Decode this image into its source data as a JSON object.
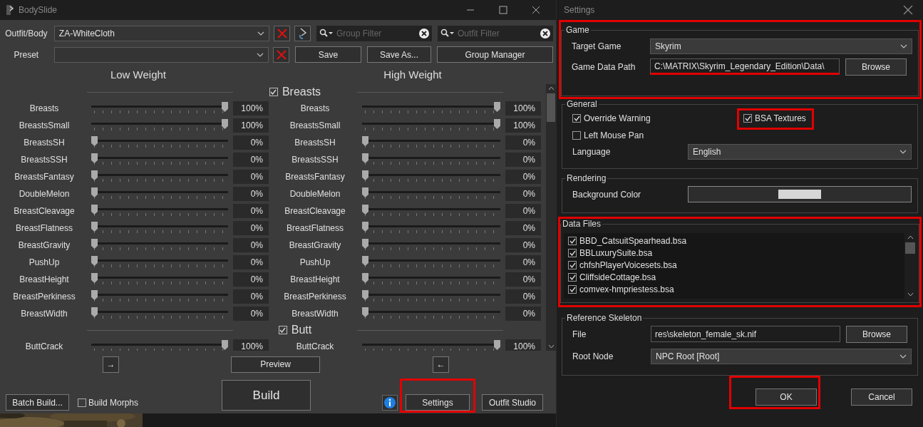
{
  "bodyslide": {
    "title": "BodySlide",
    "outfit": {
      "label": "Outfit/Body",
      "value": "ZA-WhiteCloth"
    },
    "group_filter": {
      "placeholder": "Group Filter"
    },
    "outfit_filter": {
      "placeholder": "Outfit Filter"
    },
    "preset": {
      "label": "Preset"
    },
    "preset_buttons": [
      "Save",
      "Save As...",
      "Group Manager"
    ],
    "low_heading": "Low Weight",
    "high_heading": "High Weight",
    "groups": [
      {
        "name": "Breasts",
        "checked": true,
        "sliders": [
          {
            "low": {
              "label": "Breasts",
              "level": 1,
              "value": "100%"
            },
            "high": {
              "label": "Breasts",
              "level": 1,
              "value": "100%"
            }
          },
          {
            "low": {
              "label": "BreastsSmall",
              "level": 1,
              "value": "100%"
            },
            "high": {
              "label": "BreastsSmall",
              "level": 1,
              "value": "100%"
            }
          },
          {
            "low": {
              "label": "BreastsSH",
              "level": 0,
              "value": "0%"
            },
            "high": {
              "label": "BreastsSH",
              "level": 0,
              "value": "0%"
            }
          },
          {
            "low": {
              "label": "BreastsSSH",
              "level": 0,
              "value": "0%"
            },
            "high": {
              "label": "BreastsSSH",
              "level": 0,
              "value": "0%"
            }
          },
          {
            "low": {
              "label": "BreastsFantasy",
              "level": 0,
              "value": "0%"
            },
            "high": {
              "label": "BreastsFantasy",
              "level": 0,
              "value": "0%"
            }
          },
          {
            "low": {
              "label": "DoubleMelon",
              "level": 0,
              "value": "0%"
            },
            "high": {
              "label": "DoubleMelon",
              "level": 0,
              "value": "0%"
            }
          },
          {
            "low": {
              "label": "BreastCleavage",
              "level": 0,
              "value": "0%"
            },
            "high": {
              "label": "BreastCleavage",
              "level": 0,
              "value": "0%"
            }
          },
          {
            "low": {
              "label": "BreastFlatness",
              "level": 0,
              "value": "0%"
            },
            "high": {
              "label": "BreastFlatness",
              "level": 0,
              "value": "0%"
            }
          },
          {
            "low": {
              "label": "BreastGravity",
              "level": 0,
              "value": "0%"
            },
            "high": {
              "label": "BreastGravity",
              "level": 0,
              "value": "0%"
            }
          },
          {
            "low": {
              "label": "PushUp",
              "level": 0,
              "value": "0%"
            },
            "high": {
              "label": "PushUp",
              "level": 0,
              "value": "0%"
            }
          },
          {
            "low": {
              "label": "BreastHeight",
              "level": 0,
              "value": "0%"
            },
            "high": {
              "label": "BreastHeight",
              "level": 0,
              "value": "0%"
            }
          },
          {
            "low": {
              "label": "BreastPerkiness",
              "level": 0,
              "value": "0%"
            },
            "high": {
              "label": "BreastPerkiness",
              "level": 0,
              "value": "0%"
            }
          },
          {
            "low": {
              "label": "BreastWidth",
              "level": 0,
              "value": "0%"
            },
            "high": {
              "label": "BreastWidth",
              "level": 0,
              "value": "0%"
            }
          }
        ]
      },
      {
        "name": "Butt",
        "checked": true,
        "sliders": [
          {
            "low": {
              "label": "ButtCrack",
              "level": 1,
              "value": "100%"
            },
            "high": {
              "label": "ButtCrack",
              "level": 1,
              "value": "100%"
            }
          }
        ]
      }
    ],
    "copy_right": "→",
    "preview": "Preview",
    "copy_left": "←",
    "batch_build": "Batch Build...",
    "build_morphs": {
      "label": "Build Morphs",
      "checked": false
    },
    "build": "Build",
    "settings_button": {
      "label": "Settings",
      "highlighted": true
    },
    "outfit_studio": "Outfit Studio"
  },
  "settings": {
    "title": "Settings",
    "game": {
      "legend": "Game",
      "highlighted": true,
      "target_label": "Target Game",
      "target": "Skyrim",
      "path_label": "Game Data Path",
      "path": "C:\\MATRIX\\Skyrim_Legendary_Edition\\Data\\",
      "path_underlined": true,
      "browse": "Browse"
    },
    "general": {
      "legend": "General",
      "checkboxes": [
        {
          "label": "Override Warning",
          "checked": true,
          "highlighted": false
        },
        {
          "label": "BSA Textures",
          "checked": true,
          "highlighted": true
        },
        {
          "label": "Left Mouse Pan",
          "checked": false,
          "highlighted": false
        }
      ],
      "language_label": "Language",
      "language": "English"
    },
    "rendering": {
      "legend": "Rendering",
      "color_label": "Background Color"
    },
    "data_files": {
      "legend": "Data Files",
      "highlighted": true,
      "files": [
        {
          "name": "BBD_CatsuitSpearhead.bsa",
          "checked": true
        },
        {
          "name": "BBLuxurySuite.bsa",
          "checked": true
        },
        {
          "name": "chfshPlayerVoicesets.bsa",
          "checked": true
        },
        {
          "name": "CliffsideCottage.bsa",
          "checked": true
        },
        {
          "name": "comvex-hmpriestess.bsa",
          "checked": true
        }
      ]
    },
    "skeleton": {
      "legend": "Reference Skeleton",
      "file_label": "File",
      "file": "res\\skeleton_female_sk.nif",
      "browse": "Browse",
      "root_label": "Root Node",
      "root": "NPC Root [Root]"
    },
    "buttons": [
      {
        "label": "OK",
        "highlighted": true
      },
      {
        "label": "Cancel",
        "highlighted": false
      }
    ]
  }
}
